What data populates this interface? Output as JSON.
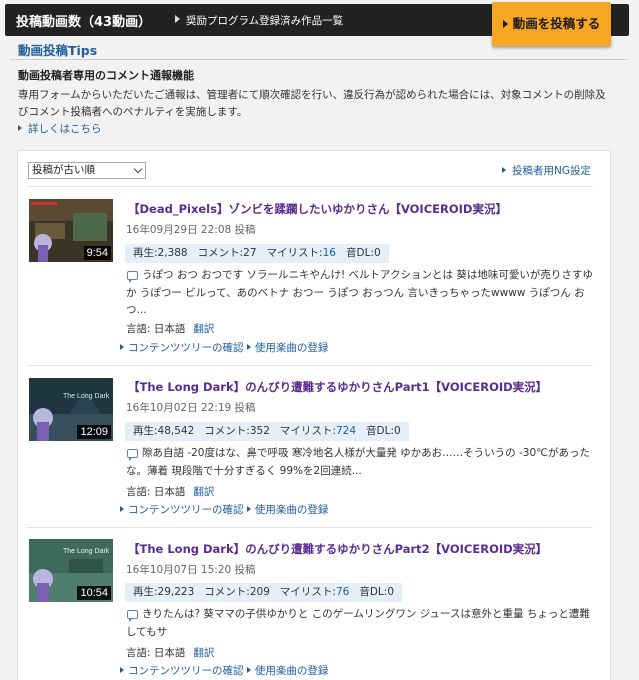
{
  "header": {
    "title": "投稿動画数（43動画）",
    "subtitle": "奨励プログラム登録済み作品一覧",
    "post_button": "動画を投稿する"
  },
  "tips": {
    "title": "動画投稿Tips",
    "heading": "動画投稿者専用のコメント通報機能",
    "body": "専用フォームからいただいたご通報は、管理者にて順次確認を行い、違反行為が認められた場合には、対象コメントの削除及びコメント投稿者へのペナルティを実施します。",
    "link": "詳しくはこちら"
  },
  "list": {
    "sort_value": "投稿が古い順",
    "ng_link": "投稿者用NG設定"
  },
  "labels": {
    "lang_prefix": "言語: ",
    "translate": "翻訳",
    "content_tree": "コンテンツツリーの確認",
    "music": "使用楽曲の登録"
  },
  "videos": [
    {
      "duration": "9:54",
      "title": "【Dead_Pixels】ゾンビを蹂躙したいゆかりさん【VOICEROID実況】",
      "date": "16年09月29日 22:08 投稿",
      "views": "再生:2,388",
      "comments": "コメント:27",
      "mylist_label": "マイリスト:",
      "mylist": "16",
      "sound": "音DL:0",
      "desc": "うぽつ おつ おつです ソラールニキやんけ! ベルトアクションとは 葵は地味可愛いが売りさすゆか うぽつー ビルって、あのベトナ おつー うぽつ おっつん 言いきっちゃったwwww うぽつん おつ...",
      "lang": "日本語"
    },
    {
      "duration": "12:09",
      "title": "【The Long Dark】のんびり遭難するゆかりさんPart1【VOICEROID実況】",
      "date": "16年10月02日 22:19 投稿",
      "views": "再生:48,542",
      "comments": "コメント:352",
      "mylist_label": "マイリスト:",
      "mylist": "724",
      "sound": "音DL:0",
      "desc": "隙あ自語 -20度はな、鼻で呼吸 寒冷地名人様が大量発 ゆかあお……そういうの -30℃があったな。薄着 現段階で十分すぎるく 99%を2回連続...",
      "lang": "日本語"
    },
    {
      "duration": "10:54",
      "title": "【The Long Dark】のんびり遭難するゆかりさんPart2【VOICEROID実況】",
      "date": "16年10月07日 15:20 投稿",
      "views": "再生:29,223",
      "comments": "コメント:209",
      "mylist_label": "マイリスト:",
      "mylist": "76",
      "sound": "音DL:0",
      "desc": "きりたんは? 葵ママの子供ゆかりと このゲームリングワン ジュースは意外と重量 ちょっと遭難してもサ",
      "lang": "日本語"
    }
  ]
}
